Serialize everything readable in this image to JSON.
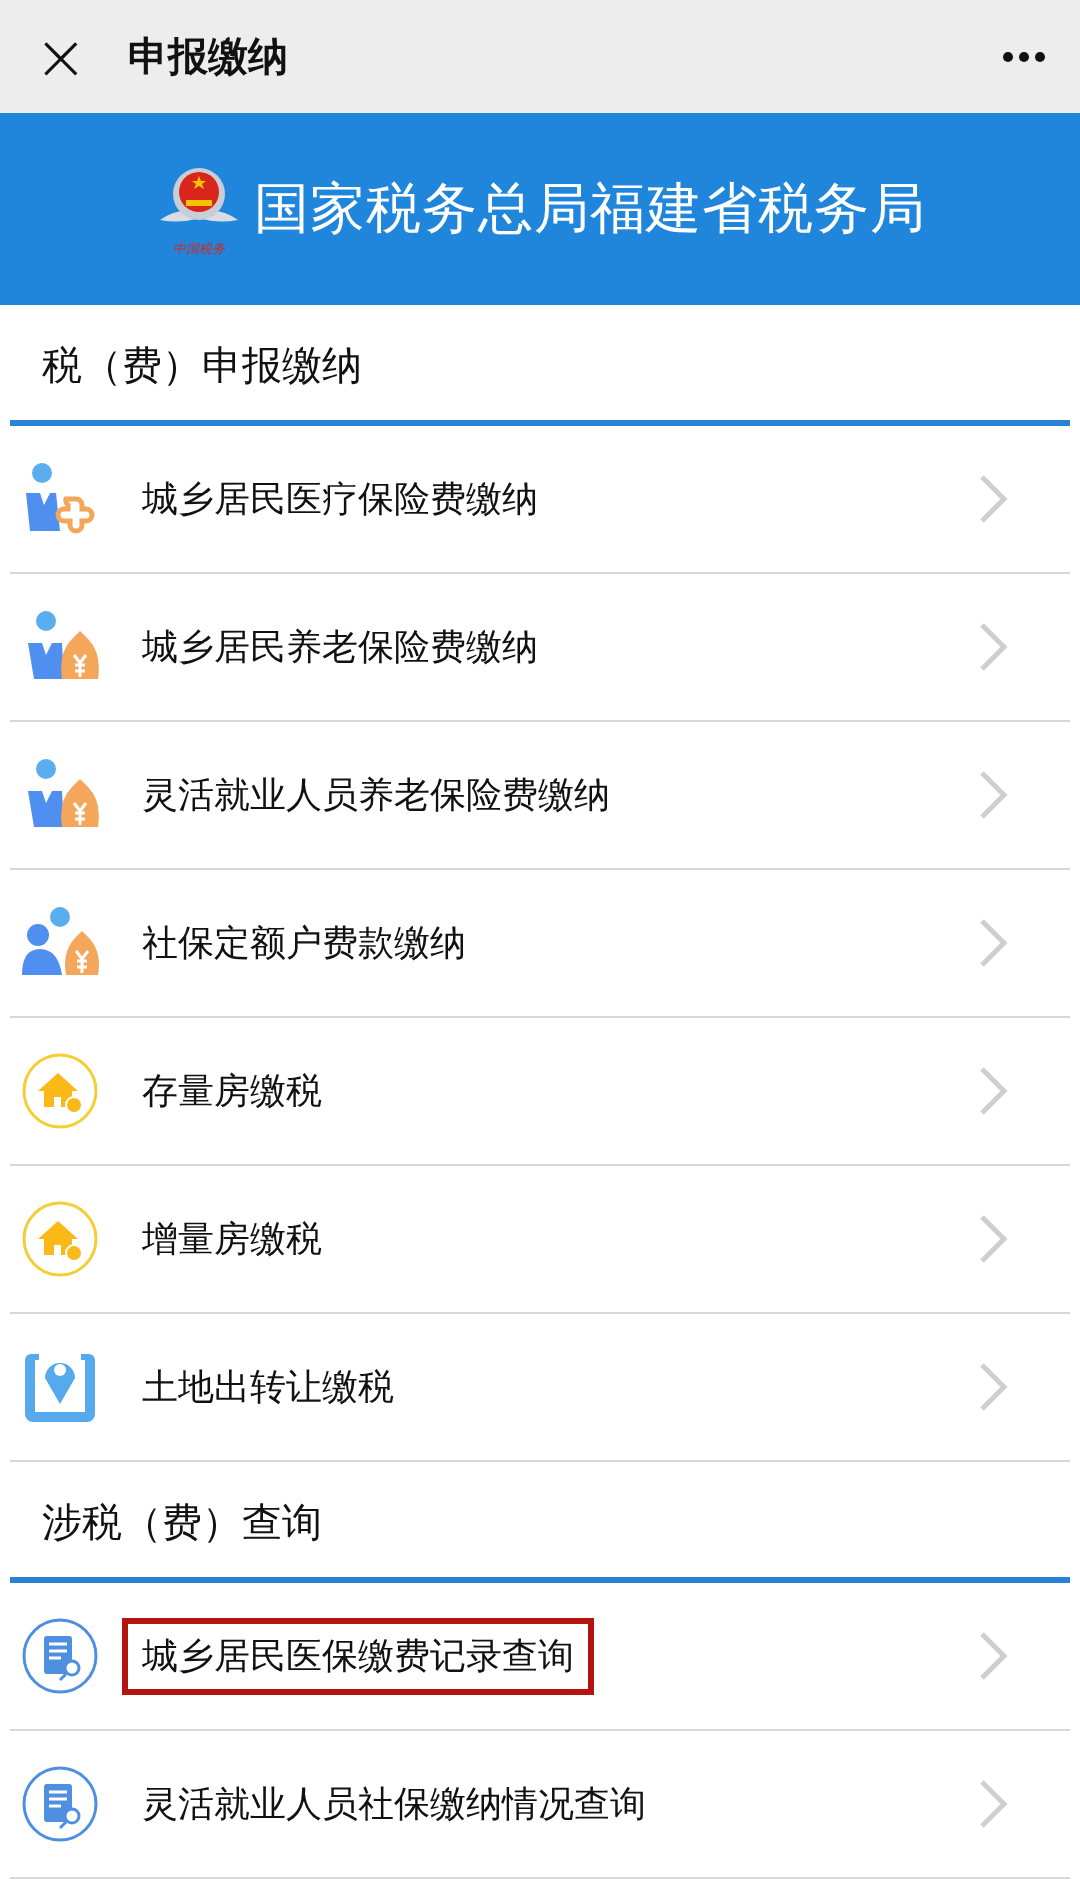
{
  "top_bar": {
    "title": "申报缴纳",
    "close_icon": "×"
  },
  "banner": {
    "emblem_caption": "中国税务",
    "title": "国家税务总局福建省税务局"
  },
  "sections": [
    {
      "title": "税（费）申报缴纳",
      "items": [
        {
          "label": "城乡居民医疗保险费缴纳",
          "kind": "medical",
          "highlighted": false
        },
        {
          "label": "城乡居民养老保险费缴纳",
          "kind": "pension",
          "highlighted": false
        },
        {
          "label": "灵活就业人员养老保险费缴纳",
          "kind": "pension",
          "highlighted": false
        },
        {
          "label": "社保定额户费款缴纳",
          "kind": "household",
          "highlighted": false
        },
        {
          "label": "存量房缴税",
          "kind": "house",
          "highlighted": false
        },
        {
          "label": "增量房缴税",
          "kind": "house",
          "highlighted": false
        },
        {
          "label": "土地出转让缴税",
          "kind": "location",
          "highlighted": false
        }
      ]
    },
    {
      "title": "涉税（费）查询",
      "items": [
        {
          "label": "城乡居民医保缴费记录查询",
          "kind": "query",
          "highlighted": true
        },
        {
          "label": "灵活就业人员社保缴纳情况查询",
          "kind": "query",
          "highlighted": false
        }
      ]
    }
  ]
}
